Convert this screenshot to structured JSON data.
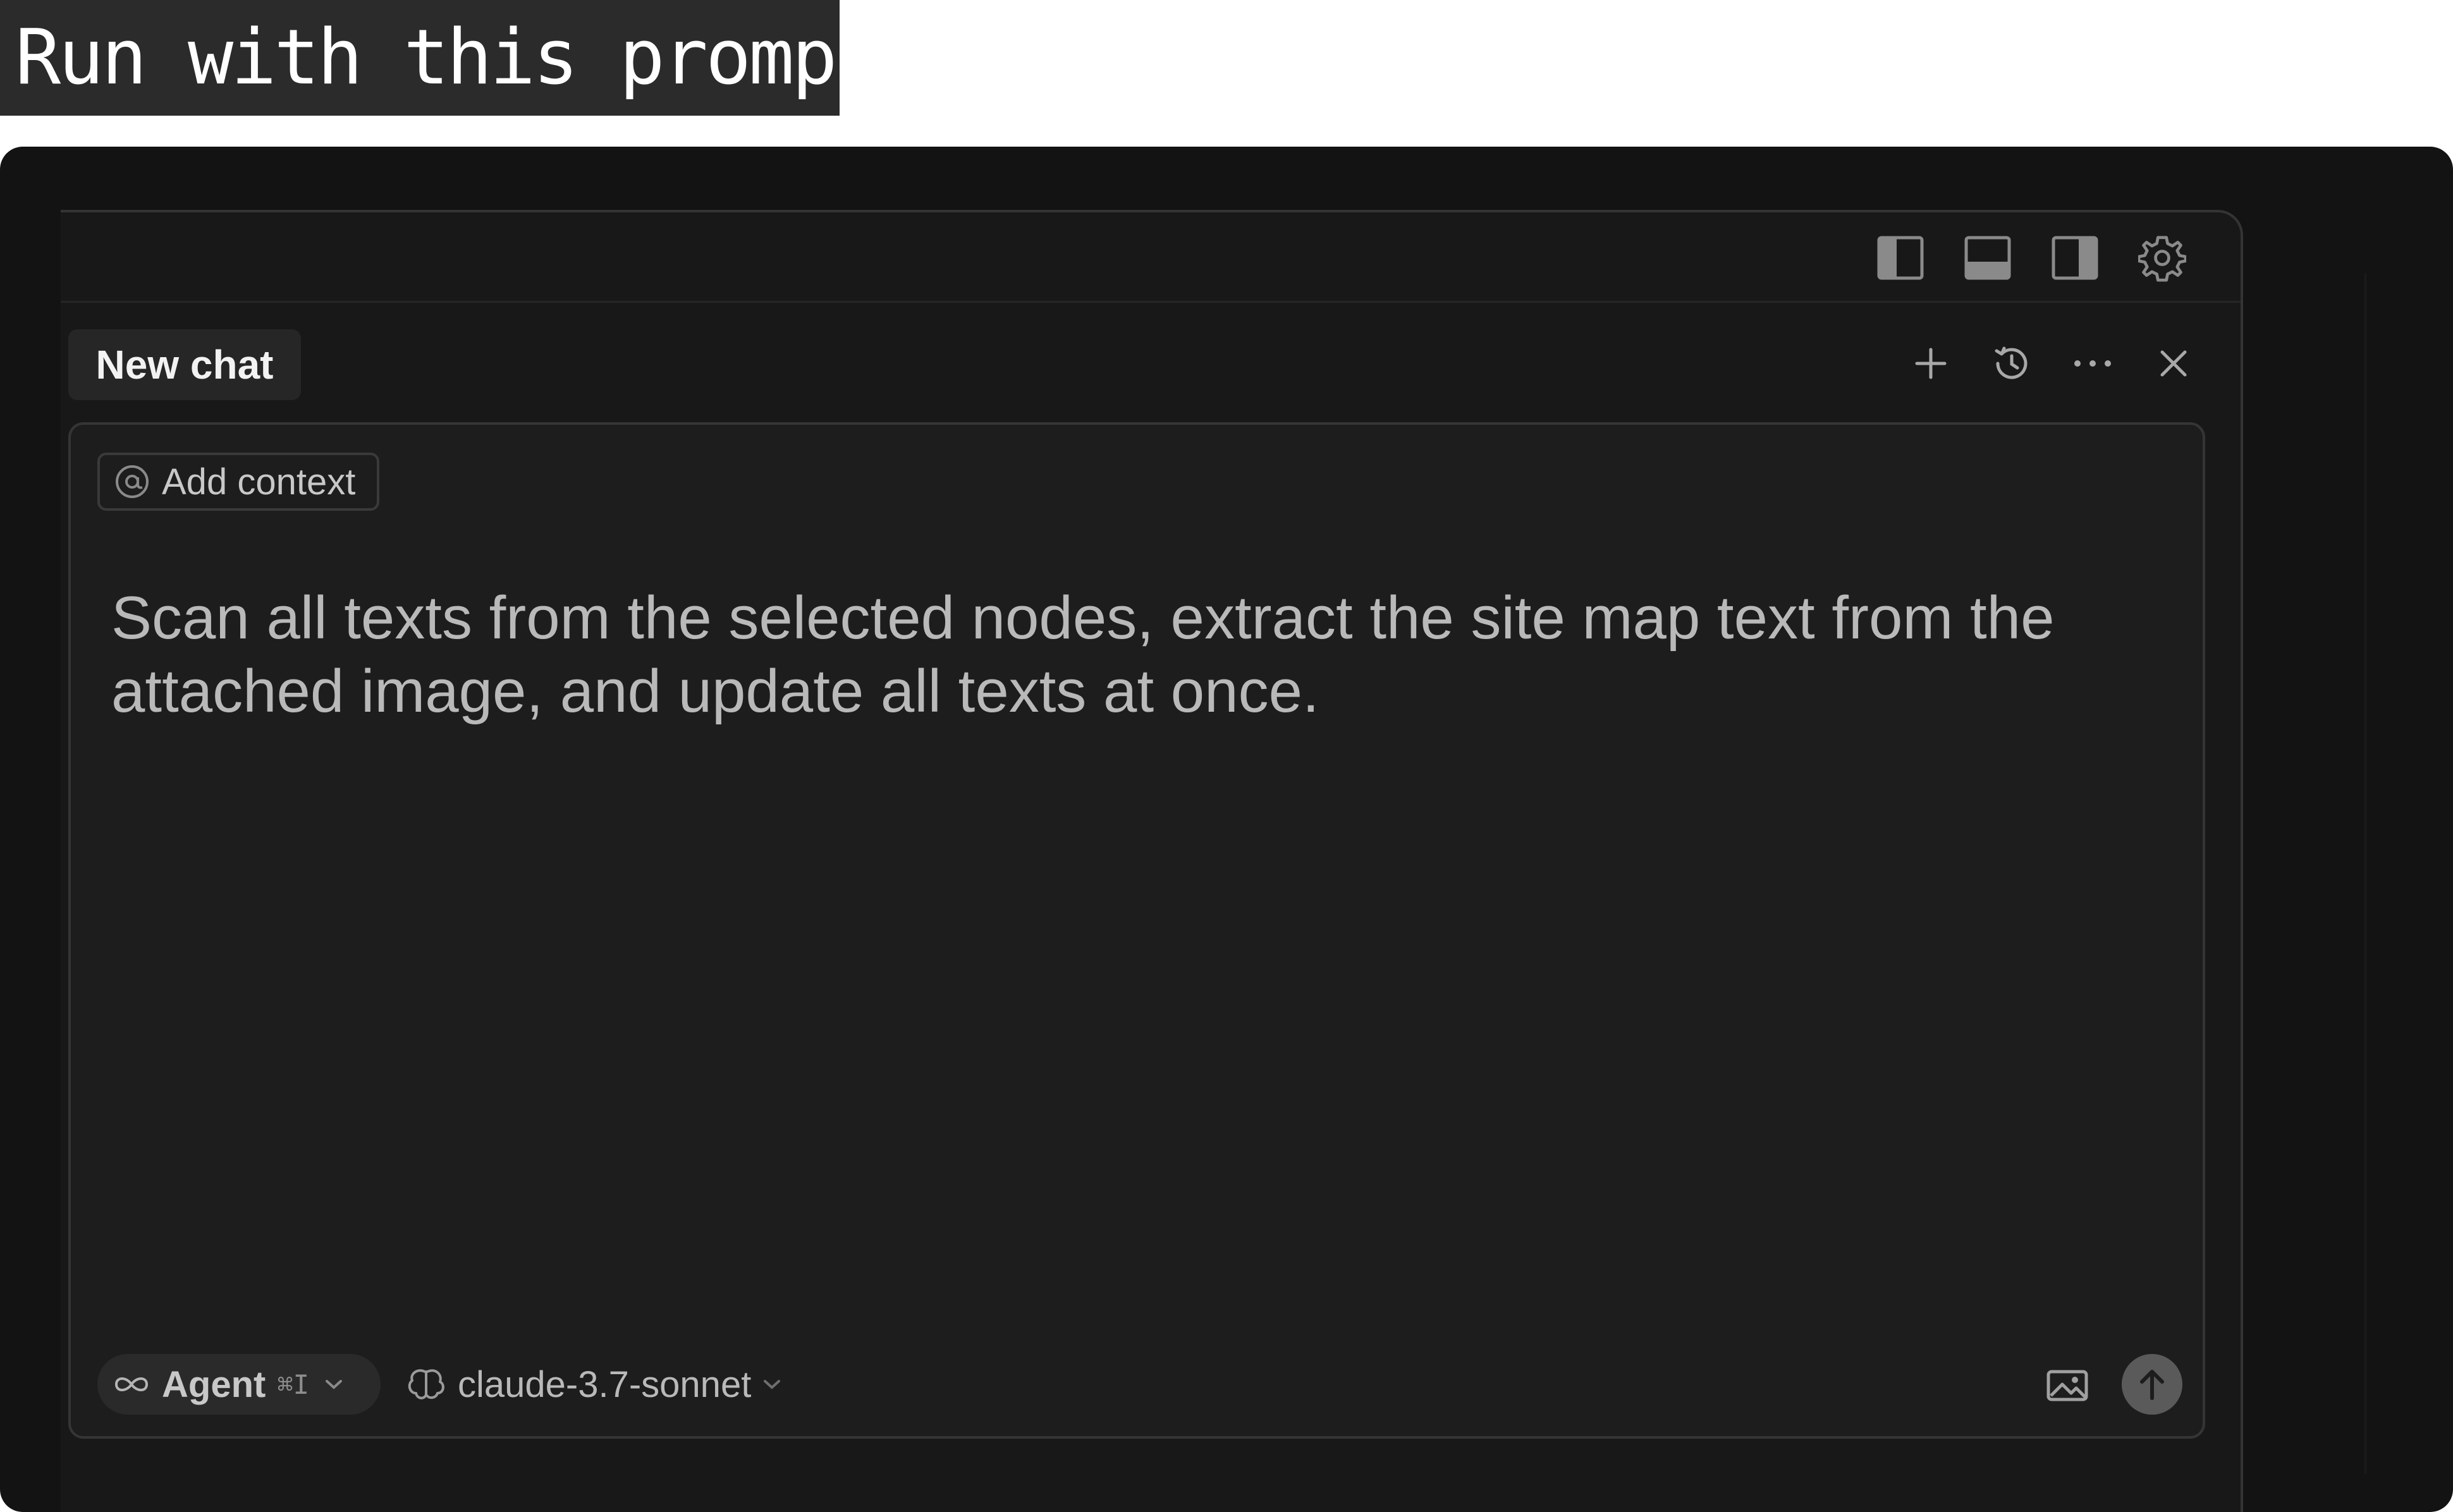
{
  "banner": {
    "text": "Run with this prompt"
  },
  "toolbar": {
    "icons": [
      "sidebar-left-icon",
      "panel-bottom-icon",
      "sidebar-right-icon",
      "gear-icon"
    ]
  },
  "chat": {
    "tab_label": "New chat",
    "actions": [
      "plus-icon",
      "history-icon",
      "more-icon",
      "close-icon"
    ]
  },
  "composer": {
    "add_context_label": "Add context",
    "prompt_text": "Scan all texts from the selected nodes, extract the site map text from the attached image, and update all texts at once.",
    "mode_label": "Agent",
    "mode_shortcut": "⌘I",
    "model_label": "claude-3.7-sonnet"
  },
  "colors": {
    "frame_bg": "#131313",
    "panel_bg": "#181818",
    "composer_bg": "#1d1d1d",
    "text_primary": "#f2f2f2",
    "text_muted": "#b9b9b9"
  }
}
